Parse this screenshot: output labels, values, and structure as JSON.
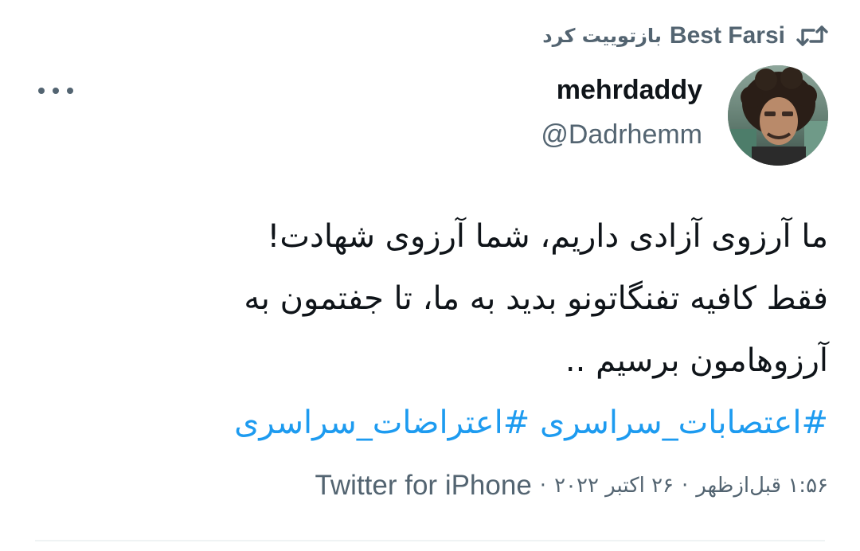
{
  "retweet": {
    "name": "Best Farsi",
    "label": "بازتوییت کرد",
    "icon": "retweet-icon"
  },
  "author": {
    "display_name": "mehrdaddy",
    "handle": "@Dadrhemm",
    "avatar": "avatar-photo"
  },
  "menu": {
    "icon": "more-options-icon"
  },
  "tweet": {
    "lines": [
      "ما آرزوی آزادی داریم، شما آرزوی شهادت!",
      "فقط کافیه تفنگاتونو بدید به ما، تا جفتمون به",
      "آرزوهامون برسیم .."
    ],
    "hashtags": [
      "#اعتصابات_سراسری",
      "#اعتراضات_سراسری"
    ]
  },
  "meta": {
    "time": "۱:۵۶ قبل‌ازظهر",
    "date": "۲۶ اکتبر ۲۰۲۲",
    "source": "Twitter for iPhone",
    "separator": "·"
  },
  "colors": {
    "text": "#0f1419",
    "secondary": "#536471",
    "link": "#1d9bf0",
    "divider": "#eff3f4"
  }
}
